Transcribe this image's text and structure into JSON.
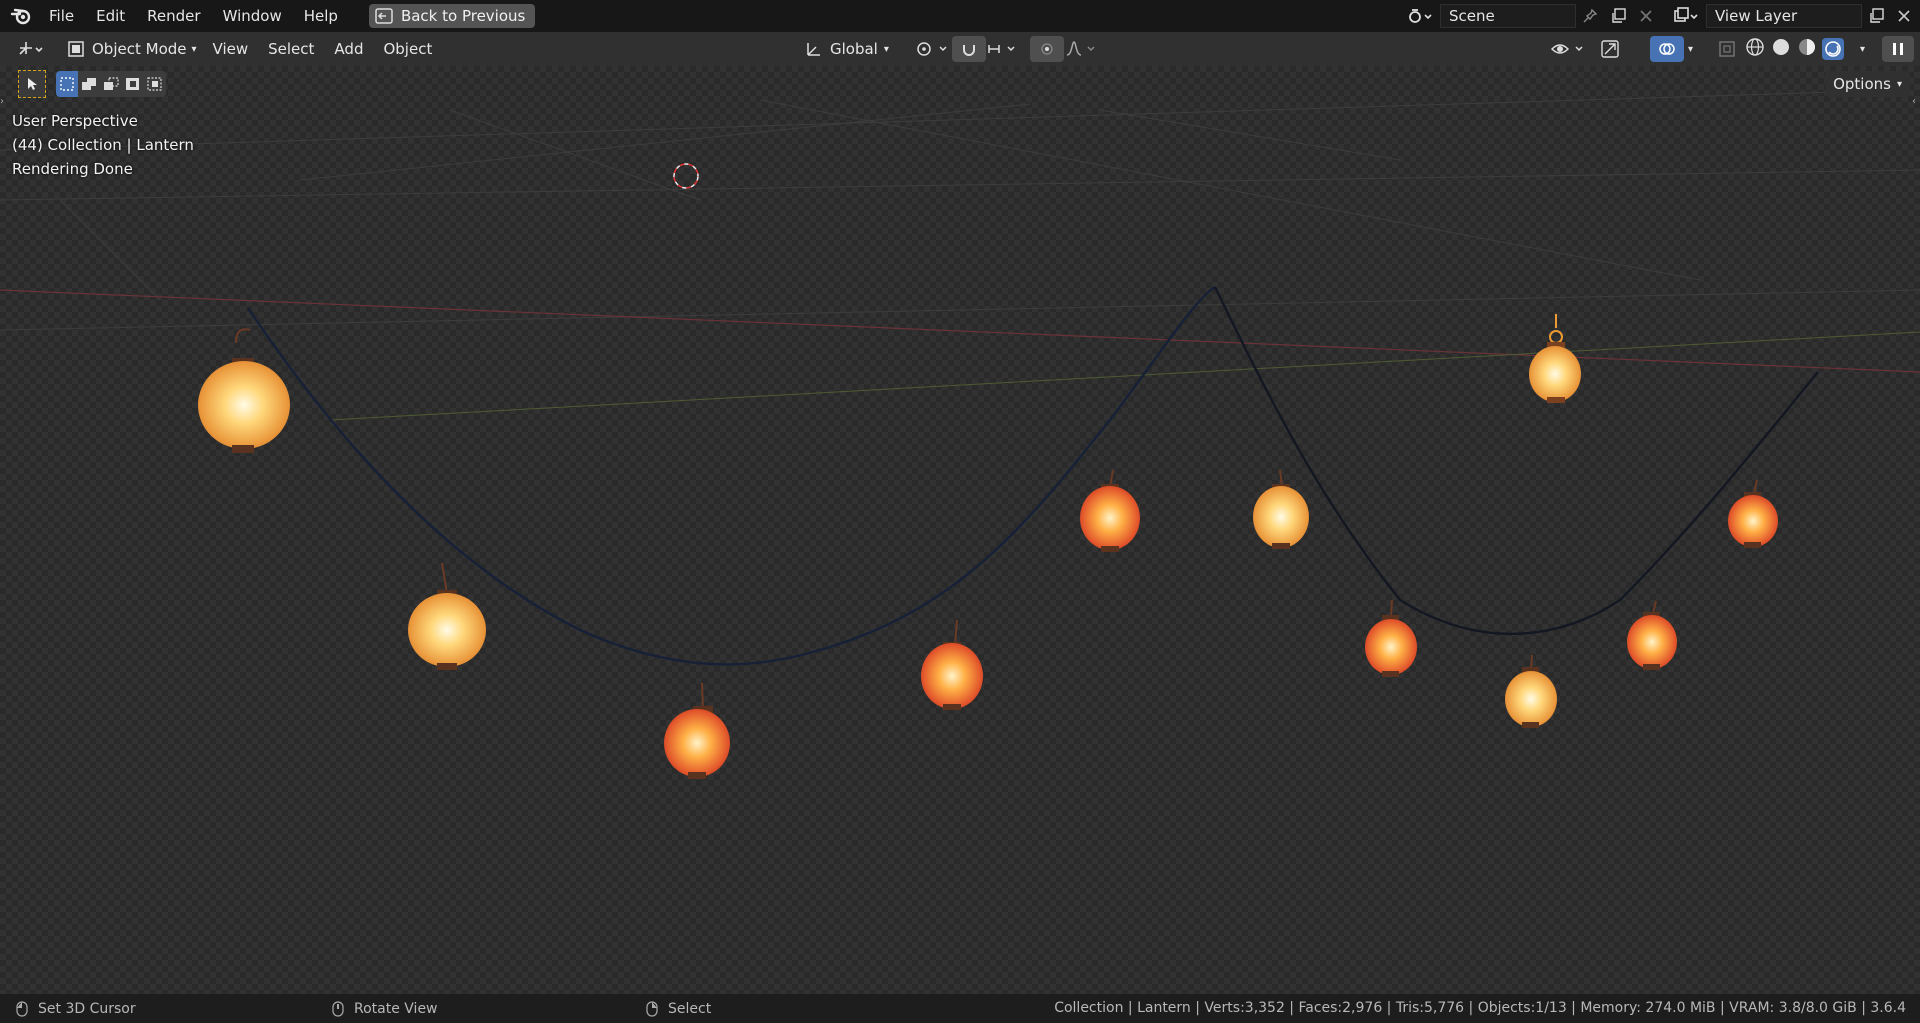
{
  "menu": {
    "file": "File",
    "edit": "Edit",
    "render": "Render",
    "window": "Window",
    "help": "Help"
  },
  "back_button": "Back to Previous",
  "scene": {
    "name": "Scene"
  },
  "view_layer": {
    "name": "View Layer"
  },
  "header": {
    "mode": "Object Mode",
    "view": "View",
    "select": "Select",
    "add": "Add",
    "object": "Object",
    "orientation": "Global"
  },
  "options_label": "Options",
  "overlay": {
    "perspective": "User Perspective",
    "collection": "(44) Collection | Lantern",
    "status": "Rendering Done"
  },
  "statusbar": {
    "hint_left": "Set 3D Cursor",
    "hint_middle": "Rotate View",
    "hint_right": "Select",
    "stats": "Collection | Lantern | Verts:3,352 | Faces:2,976 | Tris:5,776 | Objects:1/13 | Memory: 274.0 MiB | VRAM: 3.8/8.0 GiB | 3.6.4"
  },
  "colors": {
    "topbar": "#171717",
    "header": "#303030",
    "viewport": "#323232",
    "statusbar": "#1d1d1d",
    "accent": "#4772b3",
    "lantern_warm": "#f6b44a",
    "lantern_red": "#e2552d"
  }
}
